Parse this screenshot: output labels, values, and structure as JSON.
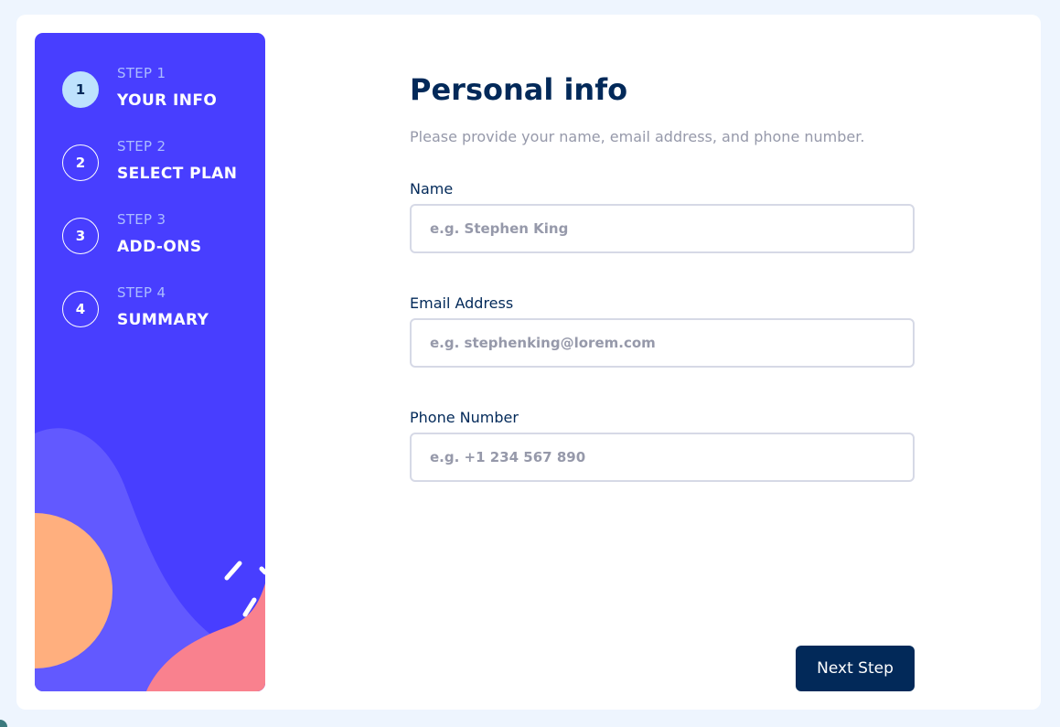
{
  "sidebar": {
    "steps": [
      {
        "number": "1",
        "label": "STEP 1",
        "title": "YOUR INFO"
      },
      {
        "number": "2",
        "label": "STEP 2",
        "title": "SELECT PLAN"
      },
      {
        "number": "3",
        "label": "STEP 3",
        "title": "ADD-ONS"
      },
      {
        "number": "4",
        "label": "STEP 4",
        "title": "SUMMARY"
      }
    ],
    "active_step": 1
  },
  "form": {
    "title": "Personal info",
    "subtitle": "Please provide your name, email address, and phone number.",
    "fields": [
      {
        "label": "Name",
        "placeholder": "e.g. Stephen King",
        "value": ""
      },
      {
        "label": "Email Address",
        "placeholder": "e.g. stephenking@lorem.com",
        "value": ""
      },
      {
        "label": "Phone Number",
        "placeholder": "e.g. +1 234 567 890",
        "value": ""
      }
    ],
    "next_button": "Next Step"
  },
  "colors": {
    "sidebar_bg": "#483eff",
    "marine_blue": "#022959",
    "active_step_bg": "#bee2fd",
    "border": "#d6d9e6",
    "grey_text": "#9699aa"
  }
}
